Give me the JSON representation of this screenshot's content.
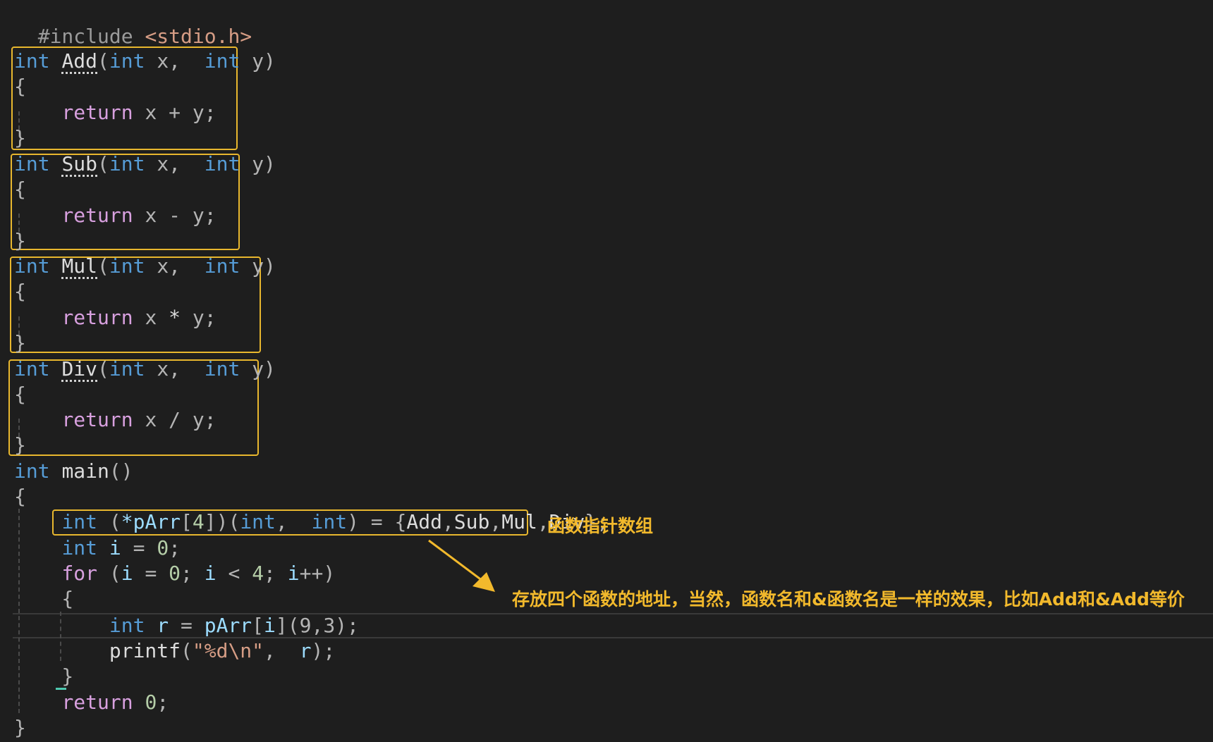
{
  "code": {
    "include": {
      "directive": "#include",
      "header": "<stdio.h>"
    },
    "functions": [
      {
        "ret": "int",
        "name": "Add",
        "p1type": "int",
        "p1": "x",
        "p2type": "int",
        "p2": "y",
        "kw": "return",
        "op": "+"
      },
      {
        "ret": "int",
        "name": "Sub",
        "p1type": "int",
        "p1": "x",
        "p2type": "int",
        "p2": "y",
        "kw": "return",
        "op": "-"
      },
      {
        "ret": "int",
        "name": "Mul",
        "p1type": "int",
        "p1": "x",
        "p2type": "int",
        "p2": "y",
        "kw": "return",
        "op": "*"
      },
      {
        "ret": "int",
        "name": "Div",
        "p1type": "int",
        "p1": "x",
        "p2type": "int",
        "p2": "y",
        "kw": "return",
        "op": "/"
      }
    ],
    "main": {
      "ret": "int",
      "name": "main",
      "decl_type": "int",
      "decl_ptr": "*pArr",
      "decl_size": "4",
      "decl_ptype1": "int",
      "decl_ptype2": "int",
      "decl_init": [
        "Add",
        "Sub",
        "Mul",
        "Div"
      ],
      "i_type": "int",
      "i_name": "i",
      "i_init": "0",
      "for_kw": "for",
      "for_limit": "4",
      "r_type": "int",
      "r_name": "r",
      "r_call": "pArr",
      "r_args": "(9,3)",
      "printf_fn": "printf",
      "printf_fmt": "\"%d\\n\"",
      "printf_arg": "r",
      "return_kw": "return",
      "return_val": "0"
    }
  },
  "annotations": {
    "array_label": "函数指针数组",
    "explanation": "存放四个函数的地址，当然，函数名和&函数名是一样的效果，比如Add和&Add等价"
  },
  "colors": {
    "highlight_box": "#e8b72e",
    "annotation_text": "#f2b92c",
    "background": "#1e1e1e"
  }
}
